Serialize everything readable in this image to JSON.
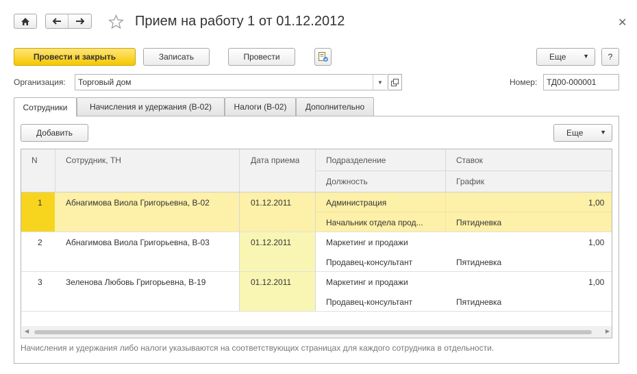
{
  "toolbar": {
    "title": "Прием на работу 1 от 01.12.2012",
    "post_close_label": "Провести и закрыть",
    "save_label": "Записать",
    "post_label": "Провести",
    "more_label": "Еще",
    "help_label": "?"
  },
  "header": {
    "org_label": "Организация:",
    "org_value": "Торговый дом",
    "number_label": "Номер:",
    "number_value": "ТД00-000001"
  },
  "tabs": [
    {
      "label": "Сотрудники"
    },
    {
      "label": "Начисления и удержания (В-02)"
    },
    {
      "label": "Налоги (В-02)"
    },
    {
      "label": "Дополнительно"
    }
  ],
  "table_toolbar": {
    "add_label": "Добавить",
    "more_label": "Еще"
  },
  "table": {
    "columns": {
      "n": "N",
      "employee": "Сотрудник, ТН",
      "date": "Дата приема",
      "department": "Подразделение",
      "position": "Должность",
      "rate": "Ставок",
      "schedule": "График"
    },
    "rows": [
      {
        "n": "1",
        "employee": "Абнагимова Виола Григорьевна, В-02",
        "date": "01.12.2011",
        "department": "Администрация",
        "position": "Начальник отдела прод...",
        "rate": "1,00",
        "schedule": "Пятидневка"
      },
      {
        "n": "2",
        "employee": "Абнагимова Виола Григорьевна, В-03",
        "date": "01.12.2011",
        "department": "Маркетинг и продажи",
        "position": "Продавец-консультант",
        "rate": "1,00",
        "schedule": "Пятидневка"
      },
      {
        "n": "3",
        "employee": "Зеленова Любовь Григорьевна, В-19",
        "date": "01.12.2011",
        "department": "Маркетинг и продажи",
        "position": "Продавец-консультант",
        "rate": "1,00",
        "schedule": "Пятидневка"
      }
    ]
  },
  "footer_note": "Начисления и удержания либо налоги указываются на соответствующих страницах для каждого сотрудника в отдельности.",
  "colors": {
    "accent": "#f5c800",
    "selected_row": "#fdf0a8",
    "date_cell": "#f9f6b4"
  }
}
